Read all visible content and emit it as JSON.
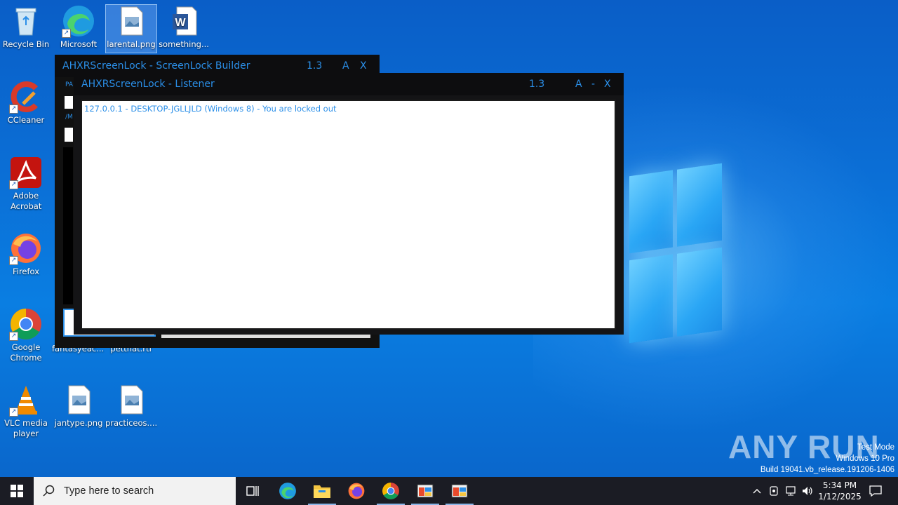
{
  "desktop": {
    "icons": {
      "recycle_bin": "Recycle Bin",
      "edge": "Microsoft Edge",
      "larental": "larental.png",
      "something": "something...",
      "ccleaner": "CCleaner",
      "acrobat": "Adobe Acrobat",
      "firefox": "Firefox",
      "chrome": "Google Chrome",
      "vlc": "VLC media player",
      "jantype": "jantype.png",
      "practiceos": "practiceos....",
      "fantasyeac": "fantasyeac...",
      "pettnat": "pettnat.rtf"
    }
  },
  "builder_window": {
    "title": "AHXRScreenLock - ScreenLock Builder",
    "version": "1.3",
    "btn_a": "A",
    "btn_close": "X",
    "label1": "PA",
    "label2": "/M"
  },
  "listener_window": {
    "title": "AHXRScreenLock - Listener",
    "version": "1.3",
    "btn_a": "A",
    "btn_min": "-",
    "btn_close": "X",
    "log_entries": [
      "127.0.0.1 - DESKTOP-JGLLJLD (Windows 8) - You are locked out"
    ]
  },
  "taskbar": {
    "search_placeholder": "Type here to search",
    "time": "5:34 PM",
    "date": "1/12/2025"
  },
  "watermark": {
    "brand": "ANY RUN",
    "line1": "Test Mode",
    "line2": "Windows 10 Pro",
    "line3": "Build 19041.vb_release.191206-1406"
  },
  "colors": {
    "accent": "#2b8fe8",
    "taskbar": "#1b1c24"
  }
}
